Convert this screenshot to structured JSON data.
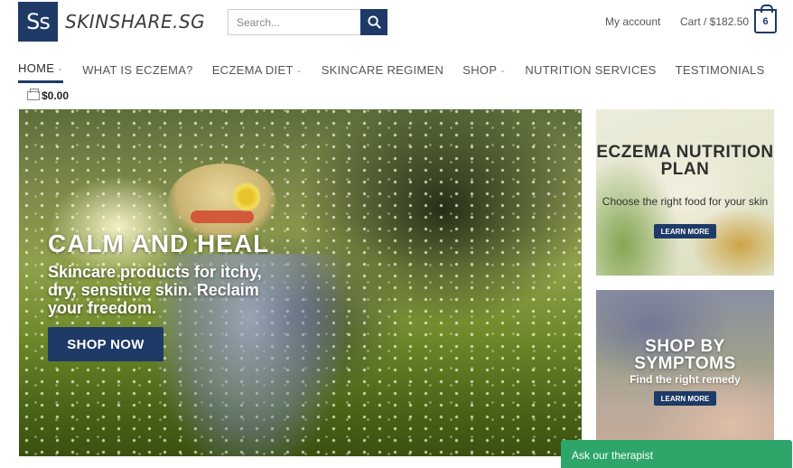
{
  "header": {
    "logo_mark": "Ss",
    "logo_text": "SKINSHARE.SG",
    "search_placeholder": "Search...",
    "account_link": "My account",
    "cart_link": "Cart / $182.50",
    "cart_count": "6"
  },
  "nav": {
    "items": [
      {
        "label": "HOME",
        "dropdown": true,
        "active": true
      },
      {
        "label": "WHAT IS ECZEMA?",
        "dropdown": false
      },
      {
        "label": "ECZEMA DIET",
        "dropdown": true
      },
      {
        "label": "SKINCARE REGIMEN",
        "dropdown": false
      },
      {
        "label": "SHOP",
        "dropdown": true
      },
      {
        "label": "NUTRITION SERVICES",
        "dropdown": false
      },
      {
        "label": "TESTIMONIALS",
        "dropdown": false
      }
    ],
    "mini_cart": "$0.00"
  },
  "hero": {
    "title": "CALM AND HEAL",
    "subtitle": "Skincare products for itchy, dry, sensitive skin. Reclaim your freedom.",
    "button": "SHOP NOW"
  },
  "banners": [
    {
      "title": "ECZEMA NUTRITION PLAN",
      "subtitle": "Choose the right food for your skin",
      "button": "LEARN MORE"
    },
    {
      "title": "SHOP BY SYMPTOMS",
      "subtitle": "Find the right remedy",
      "button": "LEARN MORE"
    }
  ],
  "chat": {
    "label": "Ask our therapist"
  },
  "colors": {
    "brand": "#1e3a66",
    "chat": "#2ea66a"
  },
  "icons": {
    "search": "search-icon",
    "cart": "cart-icon",
    "bag": "bag-icon",
    "caret": "chevron-down-icon"
  }
}
